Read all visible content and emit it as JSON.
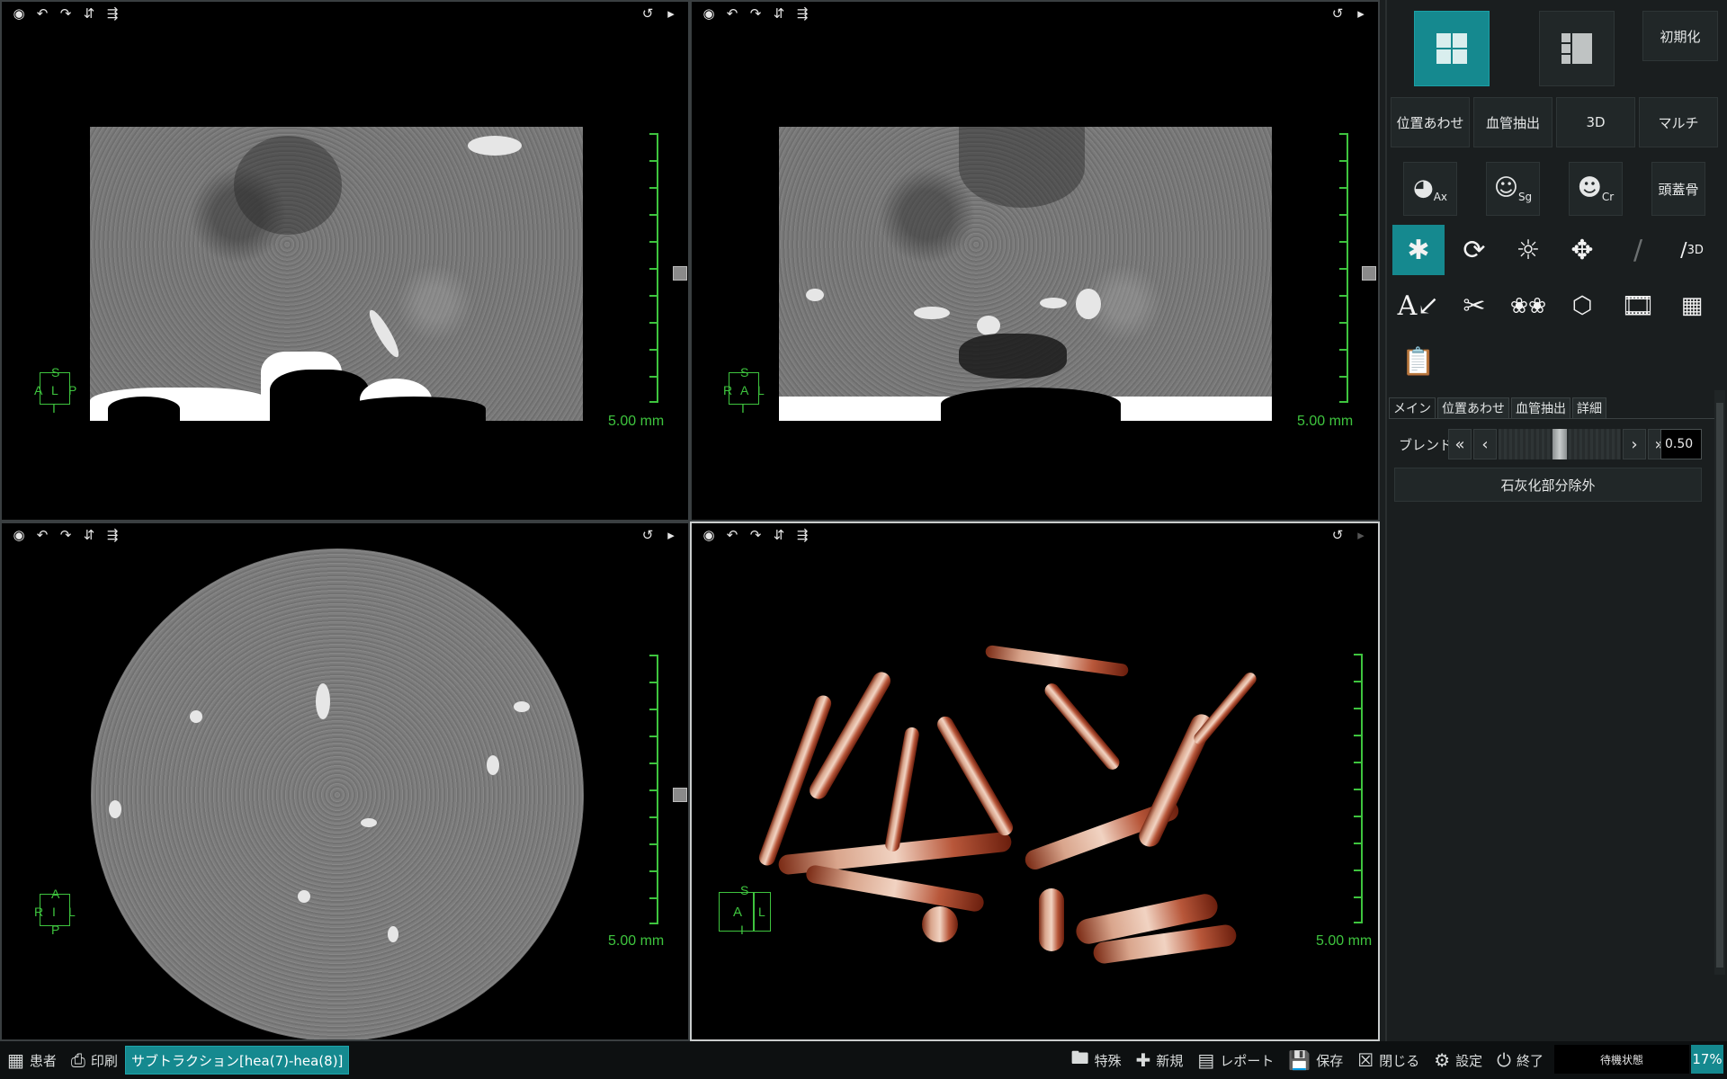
{
  "viewports": {
    "sagittal": {
      "scale_label": "5.00 mm",
      "orientation": {
        "top": "S",
        "left": "A",
        "center": "L",
        "right": "P",
        "bottom": "I"
      }
    },
    "coronal": {
      "scale_label": "5.00 mm",
      "orientation": {
        "top": "S",
        "left": "R",
        "center": "A",
        "right": "L",
        "bottom": "I"
      }
    },
    "axial": {
      "scale_label": "5.00 mm",
      "orientation": {
        "top": "A",
        "left": "R",
        "center": "I",
        "right": "L",
        "bottom": "P"
      }
    },
    "volume": {
      "scale_label": "5.00 mm",
      "orientation": {
        "top": "S",
        "left": "A",
        "center": "",
        "right": "L",
        "bottom": "I"
      }
    },
    "toolbar_icons": [
      "camera-icon",
      "rotate-left-icon",
      "rotate-right-icon",
      "flip-vertical-icon",
      "flip-horizontal-icon",
      "undo-icon",
      "maximize-icon"
    ]
  },
  "panel": {
    "reset_label": "初期化",
    "mode_buttons": [
      "位置あわせ",
      "血管抽出",
      "3D",
      "マルチ"
    ],
    "view_buttons": {
      "skull_label": "頭蓋骨"
    },
    "tabs": [
      "メイン",
      "位置あわせ",
      "血管抽出",
      "詳細"
    ],
    "blend_label": "ブレンド",
    "blend_value": "0.50",
    "blend_level": 0.5,
    "calcification_button": "石灰化部分除外"
  },
  "statusbar": {
    "patient_label": "患者",
    "print_label": "印刷",
    "active_tab": "サブトラクション[hea(7)-hea(8)]",
    "special_label": "特殊",
    "new_label": "新規",
    "report_label": "レポート",
    "save_label": "保存",
    "close_label": "閉じる",
    "settings_label": "設定",
    "exit_label": "終了",
    "status_text": "待機状態",
    "percent": "17%"
  },
  "colors": {
    "accent": "#15898f",
    "overlay_green": "#3ec43e"
  }
}
